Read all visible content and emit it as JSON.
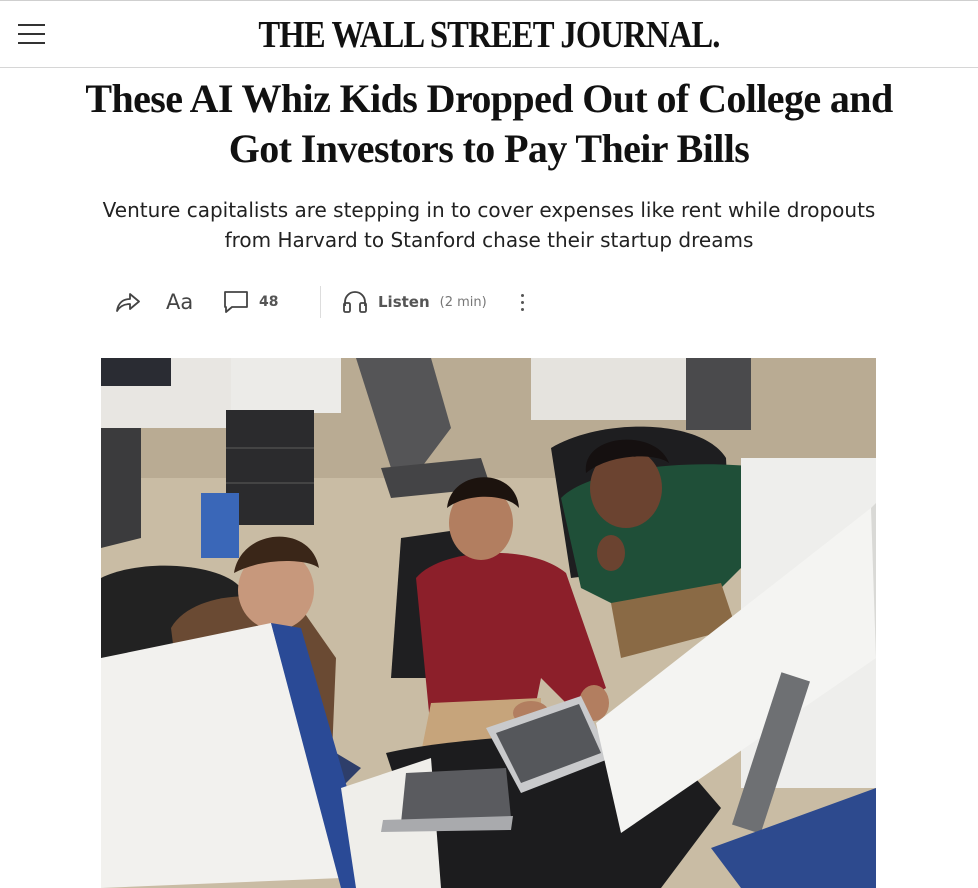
{
  "header": {
    "menu_icon": "hamburger-menu-icon",
    "masthead": "THE WALL STREET JOURNAL."
  },
  "article": {
    "headline": "These AI Whiz Kids Dropped Out of College and Got Investors to Pay Their Bills",
    "dek": "Venture capitalists are stepping in to cover expenses like rent while dropouts from Harvard to Stanford chase their startup dreams"
  },
  "toolbar": {
    "share_icon": "share-arrow-icon",
    "text_size_label": "Aa",
    "comments_icon": "comment-bubble-icon",
    "comments_count": "48",
    "listen_icon": "headphones-icon",
    "listen_label": "Listen",
    "listen_duration": "(2 min)",
    "more_icon": "more-vertical-icon"
  },
  "colors": {
    "text": "#111111",
    "muted": "#555555",
    "rule": "#d6d6d6"
  }
}
